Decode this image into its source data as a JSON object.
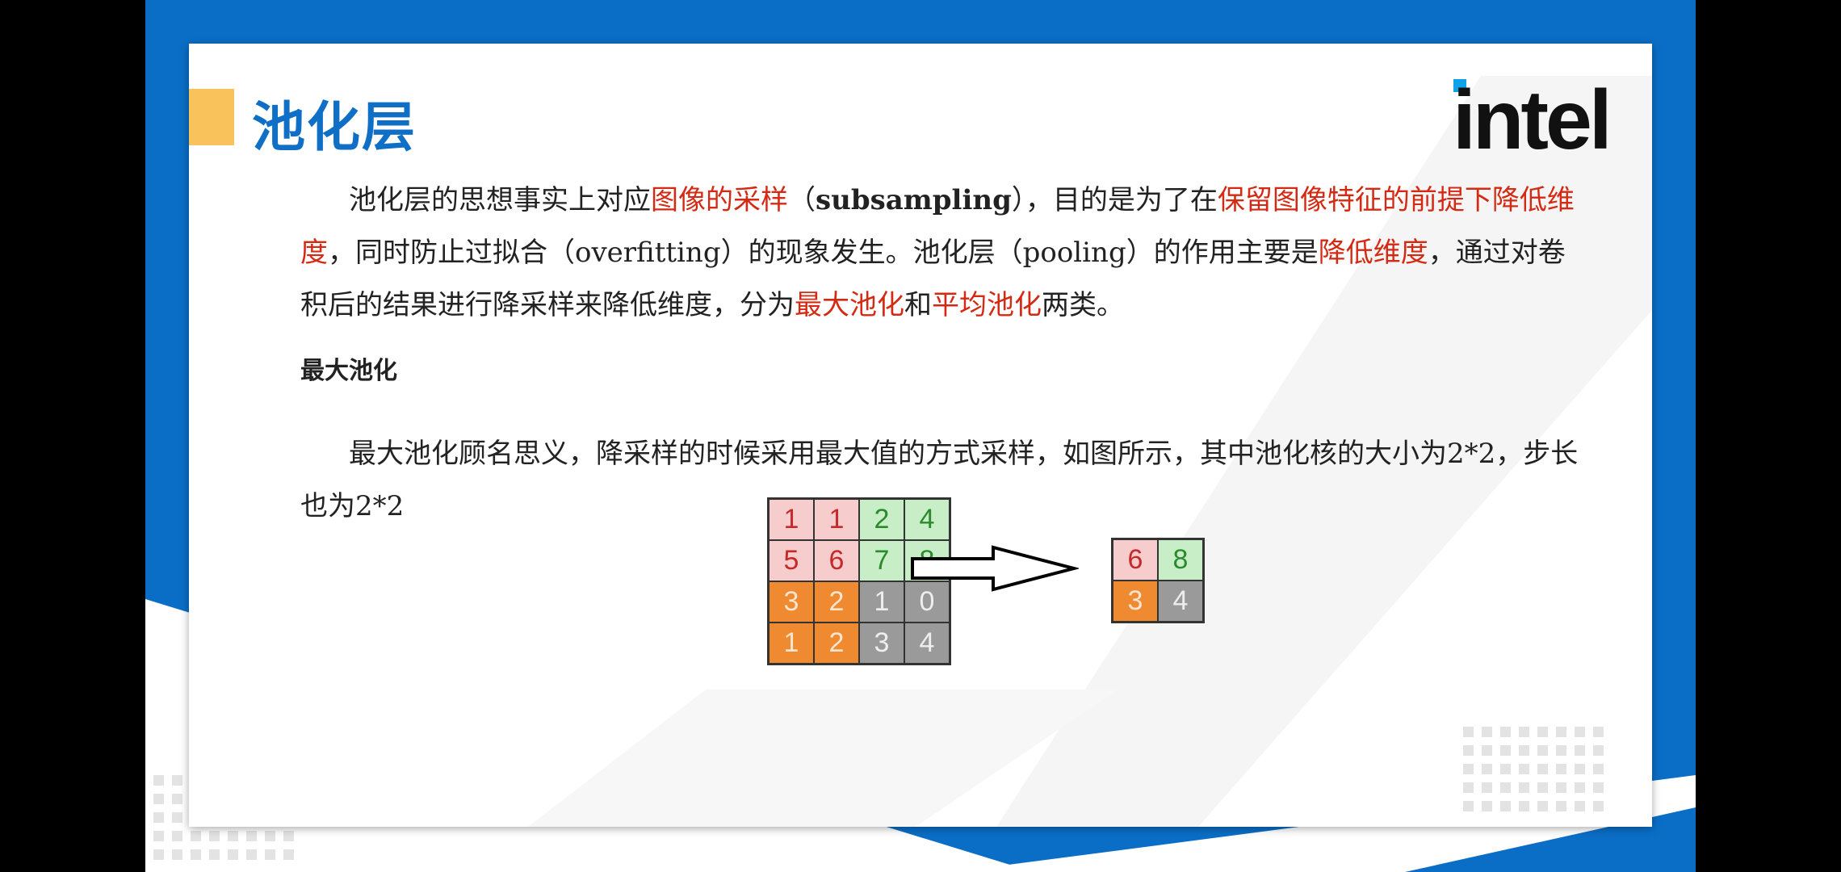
{
  "slide": {
    "title": "池化层",
    "logo_text": "intel",
    "paragraph1": {
      "t1": "池化层的思想事实上对应",
      "r1": "图像的采样",
      "t2": "（",
      "b1": "subsampling",
      "t3": "），目的是为了在",
      "r2": "保留图像特征的前提下降低维度",
      "t4": "，同时防止过拟合（overfitting）的现象发生。池化层（pooling）的作用主要是",
      "r3": "降低维度",
      "t5": "，通过对卷积后的结果进行降采样来降低维度，分为",
      "r4": "最大池化",
      "t6": "和",
      "r5": "平均池化",
      "t7": "两类。"
    },
    "subheading": "最大池化",
    "paragraph2": "最大池化顾名思义，降采样的时候采用最大值的方式采样，如图所示，其中池化核的大小为2*2，步长也为2*2"
  },
  "diagram": {
    "input": [
      {
        "v": "1",
        "c": "pink"
      },
      {
        "v": "1",
        "c": "pink"
      },
      {
        "v": "2",
        "c": "green"
      },
      {
        "v": "4",
        "c": "green"
      },
      {
        "v": "5",
        "c": "pink"
      },
      {
        "v": "6",
        "c": "pink"
      },
      {
        "v": "7",
        "c": "green"
      },
      {
        "v": "8",
        "c": "green"
      },
      {
        "v": "3",
        "c": "orange"
      },
      {
        "v": "2",
        "c": "orange"
      },
      {
        "v": "1",
        "c": "gray"
      },
      {
        "v": "0",
        "c": "gray"
      },
      {
        "v": "1",
        "c": "orange"
      },
      {
        "v": "2",
        "c": "orange"
      },
      {
        "v": "3",
        "c": "gray"
      },
      {
        "v": "4",
        "c": "gray"
      }
    ],
    "output": [
      {
        "v": "6",
        "c": "pink"
      },
      {
        "v": "8",
        "c": "green"
      },
      {
        "v": "3",
        "c": "orange"
      },
      {
        "v": "4",
        "c": "gray"
      }
    ]
  },
  "colors": {
    "frame_blue": "#0a6ec6",
    "title_blue": "#0f6fc6",
    "accent_yellow": "#f9c25b",
    "highlight_red": "#d42a13"
  }
}
